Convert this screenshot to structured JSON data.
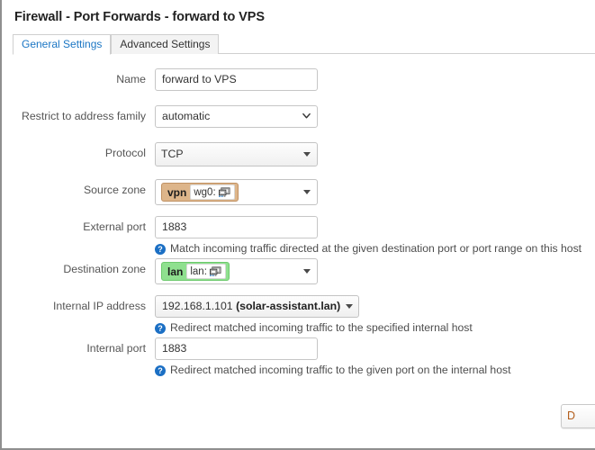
{
  "window": {
    "title": "Firewall - Port Forwards - forward to VPS"
  },
  "tabs": [
    {
      "label": "General Settings",
      "active": true
    },
    {
      "label": "Advanced Settings",
      "active": false
    }
  ],
  "form": {
    "name": {
      "label": "Name",
      "value": "forward to VPS",
      "placeholder": ""
    },
    "restrict_family": {
      "label": "Restrict to address family",
      "value": "automatic",
      "icon": "chevron-down-icon"
    },
    "protocol": {
      "label": "Protocol",
      "value": "TCP",
      "icon": "caret-down-icon"
    },
    "source_zone": {
      "label": "Source zone",
      "zone": "vpn",
      "iface_label": "wg0:",
      "iface_icon": "ethernet-device-icon",
      "zone_color": "#ddb58a",
      "icon": "caret-down-icon"
    },
    "external_port": {
      "label": "External port",
      "value": "1883",
      "help": "Match incoming traffic directed at the given destination port or port range on this host",
      "help_icon": "question-circle-icon"
    },
    "destination_zone": {
      "label": "Destination zone",
      "zone": "lan",
      "iface_label": "lan:",
      "iface_icon": "ethernet-device-icon",
      "zone_color": "#8fe08f",
      "icon": "caret-down-icon"
    },
    "internal_ip": {
      "label": "Internal IP address",
      "value_ip": "192.168.1.101",
      "value_host": "(solar-assistant.lan)",
      "help": "Redirect matched incoming traffic to the specified internal host",
      "help_icon": "question-circle-icon",
      "icon": "caret-down-icon"
    },
    "internal_port": {
      "label": "Internal port",
      "value": "1883",
      "help": "Redirect matched incoming traffic to the given port on the internal host",
      "help_icon": "question-circle-icon"
    }
  },
  "footer": {
    "button_label": "D"
  },
  "colors": {
    "accent_link": "#1b76c4",
    "help_icon": "#1b6fc4",
    "zone_vpn": "#ddb58a",
    "zone_lan": "#8fe08f",
    "footer_button_text": "#b35c19"
  }
}
